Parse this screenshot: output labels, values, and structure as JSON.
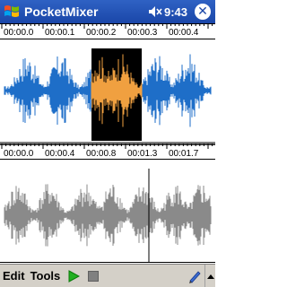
{
  "app": {
    "title": "PocketMixer"
  },
  "status": {
    "time": "9:43"
  },
  "icons": {
    "start": "windows-flag-icon",
    "volume": "speaker-muted-icon",
    "close": "close-icon",
    "play": "play-icon",
    "stop": "stop-icon",
    "pen": "pen-icon",
    "sip": "up-arrow-icon"
  },
  "colors": {
    "titlebar": "#1f4fb5",
    "waveform_top": "#1e6ec8",
    "waveform_selected": "#f0a040",
    "selection_bg": "#000000",
    "waveform_bottom": "#8a8a8a",
    "menubar": "#d4d0c8"
  },
  "top_track": {
    "ruler_labels": [
      "00:00.0",
      "00:00.1",
      "00:00.2",
      "00:00.3",
      "00:00.4"
    ]
  },
  "bottom_track": {
    "ruler_labels": [
      "00:00.0",
      "00:00.4",
      "00:00.8",
      "00:01.3",
      "00:01.7"
    ]
  },
  "menu": {
    "edit": "Edit",
    "tools": "Tools"
  },
  "close_glyph": "✕"
}
